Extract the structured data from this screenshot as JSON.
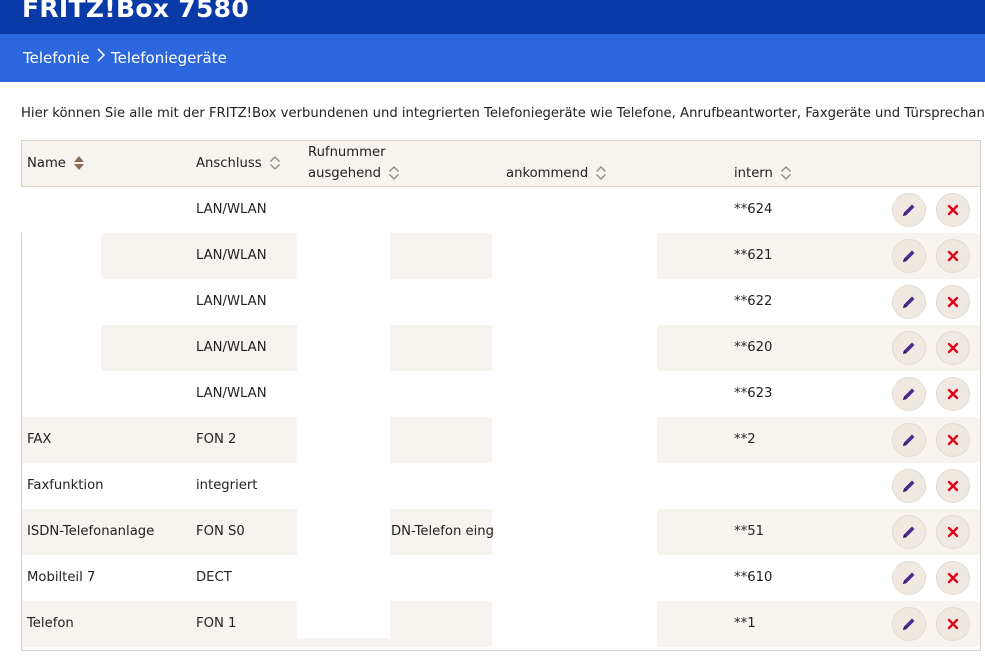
{
  "app": {
    "title": "FRITZ!Box 7580"
  },
  "breadcrumb": {
    "section": "Telefonie",
    "page": "Telefoniegeräte"
  },
  "intro_text": "Hier können Sie alle mit der FRITZ!Box verbundenen und integrierten Telefoniegeräte wie Telefone, Anrufbeantworter, Faxgeräte und Türsprechan",
  "table": {
    "headers": {
      "name": "Name",
      "anschluss": "Anschluss",
      "rufnummer": "Rufnummer",
      "ausgehend": "ausgehend",
      "ankommend": "ankommend",
      "intern": "intern"
    },
    "sorted_column": "name",
    "rows": [
      {
        "name": "",
        "anschluss": "LAN/WLAN",
        "ausgehend": "",
        "ankommend": "",
        "intern": "**624"
      },
      {
        "name": "",
        "anschluss": "LAN/WLAN",
        "ausgehend": "",
        "ankommend": "",
        "intern": "**621"
      },
      {
        "name": "",
        "anschluss": "LAN/WLAN",
        "ausgehend": "",
        "ankommend": "",
        "intern": "**622"
      },
      {
        "name": "",
        "anschluss": "LAN/WLAN",
        "ausgehend": "",
        "ankommend": "",
        "intern": "**620"
      },
      {
        "name": "",
        "anschluss": "LAN/WLAN",
        "ausgehend": "",
        "ankommend": "",
        "intern": "**623"
      },
      {
        "name": "FAX",
        "anschluss": "FON 2",
        "ausgehend": "",
        "ankommend": "",
        "intern": "**2"
      },
      {
        "name": "Faxfunktion",
        "anschluss": "integriert",
        "ausgehend": "",
        "ankommend": "",
        "intern": ""
      },
      {
        "name": "ISDN-Telefonanlage",
        "anschluss": "FON S0",
        "ausgehend": "DN-Telefon einge",
        "ankommend": "",
        "intern": "**51"
      },
      {
        "name": "Mobilteil 7",
        "anschluss": "DECT",
        "ausgehend": "",
        "ankommend": "",
        "intern": "**610"
      },
      {
        "name": "Telefon",
        "anschluss": "FON 1",
        "ausgehend": "",
        "ankommend": "",
        "intern": "**1"
      }
    ]
  },
  "icons": {
    "edit": "pencil-icon",
    "delete": "close-icon",
    "sort": "sort-arrows-icon",
    "separator": "chevron-right-icon"
  },
  "colors": {
    "header_bg": "#0a3aa8",
    "breadcrumb_bg": "#2d67de",
    "row_alt": "#f7f3ee",
    "edit_icon": "#4a2a8c",
    "delete_icon": "#e2001a"
  }
}
